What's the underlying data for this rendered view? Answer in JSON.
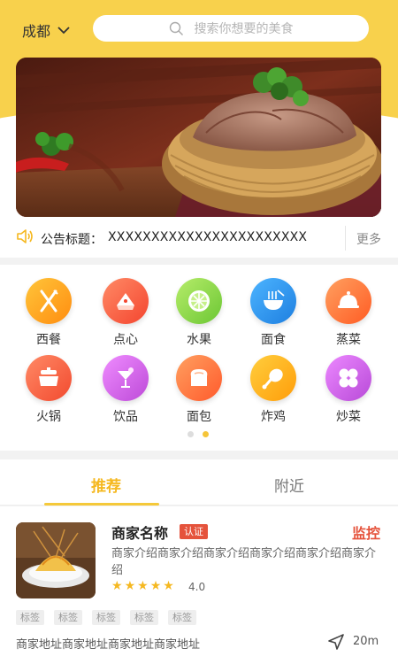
{
  "header": {
    "city": "成都",
    "search_placeholder": "搜索你想要的美食"
  },
  "banner": {
    "image": "plate of sliced braised meat in a woven bamboo basket",
    "slide_count": 3,
    "active_slide": 2
  },
  "notice": {
    "label": "公告标题：",
    "content": "XXXXXXXXXXXXXXXXXXXXXXX",
    "more": "更多"
  },
  "categories": {
    "items": [
      {
        "label": "西餐",
        "icon": "knife-fork-icon",
        "color": "#ffad1f"
      },
      {
        "label": "点心",
        "icon": "dessert-icon",
        "color": "#f9684f"
      },
      {
        "label": "水果",
        "icon": "lime-slice-icon",
        "color": "#8fd64a"
      },
      {
        "label": "面食",
        "icon": "noodle-bowl-icon",
        "color": "#2f98ee"
      },
      {
        "label": "蒸菜",
        "icon": "cloche-icon",
        "color": "#ff7a3c"
      },
      {
        "label": "火锅",
        "icon": "hotpot-icon",
        "color": "#fb6347"
      },
      {
        "label": "饮品",
        "icon": "cocktail-icon",
        "color": "#d368e8"
      },
      {
        "label": "面包",
        "icon": "bread-icon",
        "color": "#ff7c44"
      },
      {
        "label": "炸鸡",
        "icon": "drumstick-icon",
        "color": "#ffb41e"
      },
      {
        "label": "炒菜",
        "icon": "clover-icon",
        "color": "#ce63e8"
      }
    ],
    "page_count": 2,
    "active_page": 2
  },
  "tabs": [
    {
      "label": "推荐",
      "active": true
    },
    {
      "label": "附近",
      "active": false
    }
  ],
  "merchant": {
    "name": "商家名称",
    "badge": "认证",
    "action": "监控",
    "description": "商家介绍商家介绍商家介绍商家介绍商家介绍商家介绍",
    "rating": 4.0,
    "rating_text": "4.0",
    "stars": 5,
    "tags": [
      "标签",
      "标签",
      "标签",
      "标签",
      "标签"
    ],
    "address": "商家地址商家地址商家地址商家地址",
    "distance": "20m"
  },
  "colors": {
    "accent": "#f5c53a",
    "header_bg": "#f8d14c",
    "badge": "#e5533c",
    "star": "#f5b820"
  }
}
